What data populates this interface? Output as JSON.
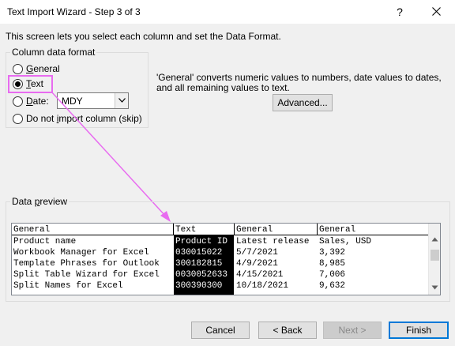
{
  "window": {
    "title": "Text Import Wizard - Step 3 of 3",
    "help": "?",
    "close_icon": "close-icon"
  },
  "intro": "This screen lets you select each column and set the Data Format.",
  "column_format": {
    "title": "Column data format",
    "general_pre": "",
    "general_u": "G",
    "general_post": "eneral",
    "text_pre": "",
    "text_u": "T",
    "text_post": "ext",
    "date_pre": "",
    "date_u": "D",
    "date_post": "ate:",
    "date_value": "MDY",
    "skip_pre": "Do not ",
    "skip_u": "i",
    "skip_post": "mport column (skip)",
    "selected": "text"
  },
  "description": "'General' converts numeric values to numbers, date values to dates, and all remaining values to text.",
  "advanced_label": "Advanced...",
  "preview": {
    "title_pre": "Data ",
    "title_u": "p",
    "title_post": "review",
    "headers": [
      "General",
      "Text",
      "General",
      "General"
    ],
    "rows": [
      [
        "Product name",
        "Product ID",
        "Latest release",
        "Sales, USD"
      ],
      [
        "Workbook Manager for Excel",
        "030015022",
        "5/7/2021",
        "3,392"
      ],
      [
        "Template Phrases for Outlook",
        "300182815",
        "4/9/2021",
        "8,985"
      ],
      [
        "Split Table Wizard for Excel",
        "0030052633",
        "4/15/2021",
        "7,006"
      ],
      [
        "Split Names for Excel",
        "300390300",
        "10/18/2021",
        "9,632"
      ]
    ]
  },
  "buttons": {
    "cancel": "Cancel",
    "back": "< Back",
    "next": "Next >",
    "finish": "Finish"
  },
  "colors": {
    "annotation": "#e86bf0",
    "accent": "#0078d7"
  }
}
